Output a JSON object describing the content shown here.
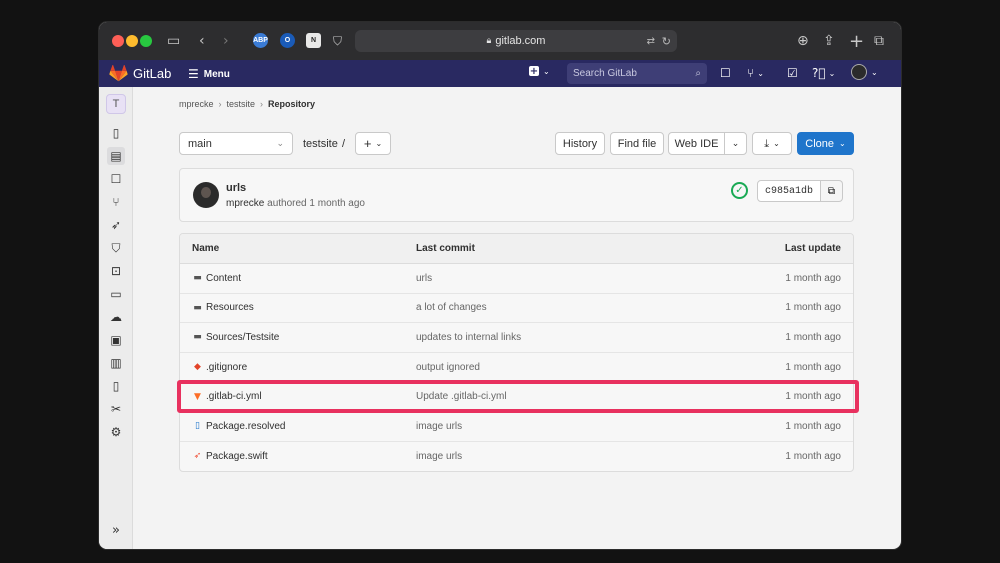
{
  "browser": {
    "url": "gitlab.com"
  },
  "gitlab": {
    "brand": "GitLab",
    "menu_label": "Menu",
    "search_placeholder": "Search GitLab",
    "project_avatar": "T"
  },
  "breadcrumb": [
    "mprecke",
    "testsite",
    "Repository"
  ],
  "repo": {
    "branch": "main",
    "path": "testsite",
    "path_sep": "/",
    "buttons": {
      "history": "History",
      "find_file": "Find file",
      "web_ide": "Web IDE",
      "clone": "Clone"
    }
  },
  "commit": {
    "title": "urls",
    "author": "mprecke",
    "authored_text": "authored 1 month ago",
    "sha": "c985a1db",
    "pipeline_status": "passed"
  },
  "table": {
    "headers": {
      "name": "Name",
      "last_commit": "Last commit",
      "last_update": "Last update"
    },
    "rows": [
      {
        "name": "Content",
        "type": "folder",
        "commit": "urls",
        "date": "1 month ago"
      },
      {
        "name": "Resources",
        "type": "folder",
        "commit": "a lot of changes",
        "date": "1 month ago"
      },
      {
        "name": "Sources/Testsite",
        "type": "folder",
        "commit": "updates to internal links",
        "date": "1 month ago"
      },
      {
        "name": ".gitignore",
        "type": "git-file",
        "commit": "output ignored",
        "date": "1 month ago"
      },
      {
        "name": ".gitlab-ci.yml",
        "type": "gitlab-file",
        "commit": "Update .gitlab-ci.yml",
        "date": "1 month ago"
      },
      {
        "name": "Package.resolved",
        "type": "file",
        "commit": "image urls",
        "date": "1 month ago"
      },
      {
        "name": "Package.swift",
        "type": "swift-file",
        "commit": "image urls",
        "date": "1 month ago"
      }
    ]
  },
  "colors": {
    "header_bg": "#292961",
    "highlight": "#e8315f",
    "primary": "#1f75cb",
    "success": "#1aaa55"
  }
}
